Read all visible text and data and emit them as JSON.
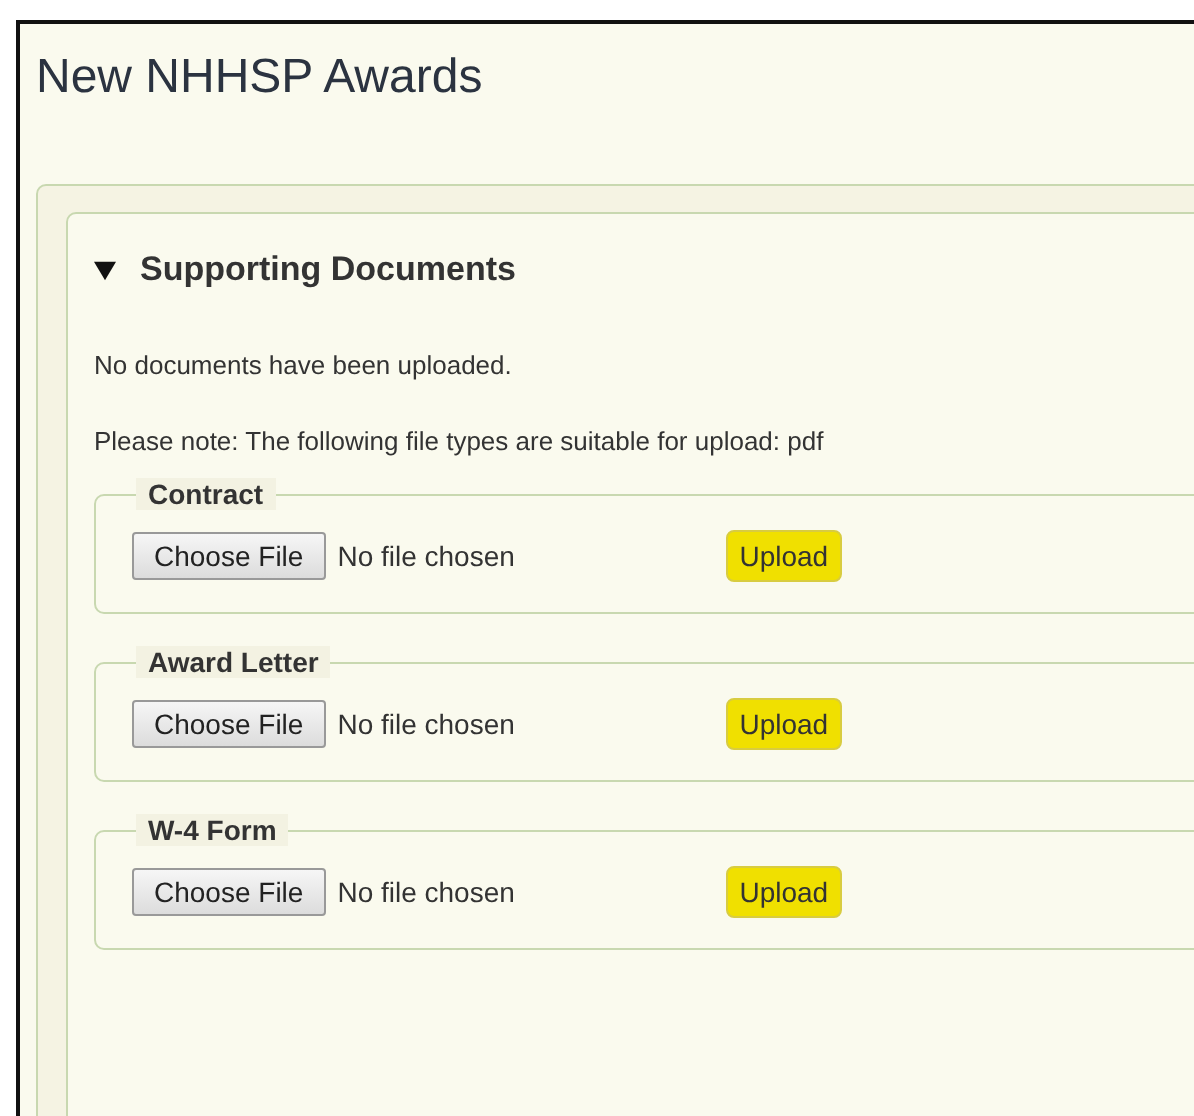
{
  "page": {
    "title": "New NHHSP Awards"
  },
  "section": {
    "title": "Supporting Documents",
    "expanded": true,
    "messages": [
      "No documents have been uploaded.",
      "Please note: The following file types are suitable for upload: pdf"
    ],
    "uploads": [
      {
        "legend": "Contract",
        "choose_label": "Choose File",
        "file_status": "No file chosen",
        "upload_label": "Upload"
      },
      {
        "legend": "Award Letter",
        "choose_label": "Choose File",
        "file_status": "No file chosen",
        "upload_label": "Upload"
      },
      {
        "legend": "W-4 Form",
        "choose_label": "Choose File",
        "file_status": "No file chosen",
        "upload_label": "Upload"
      }
    ]
  }
}
